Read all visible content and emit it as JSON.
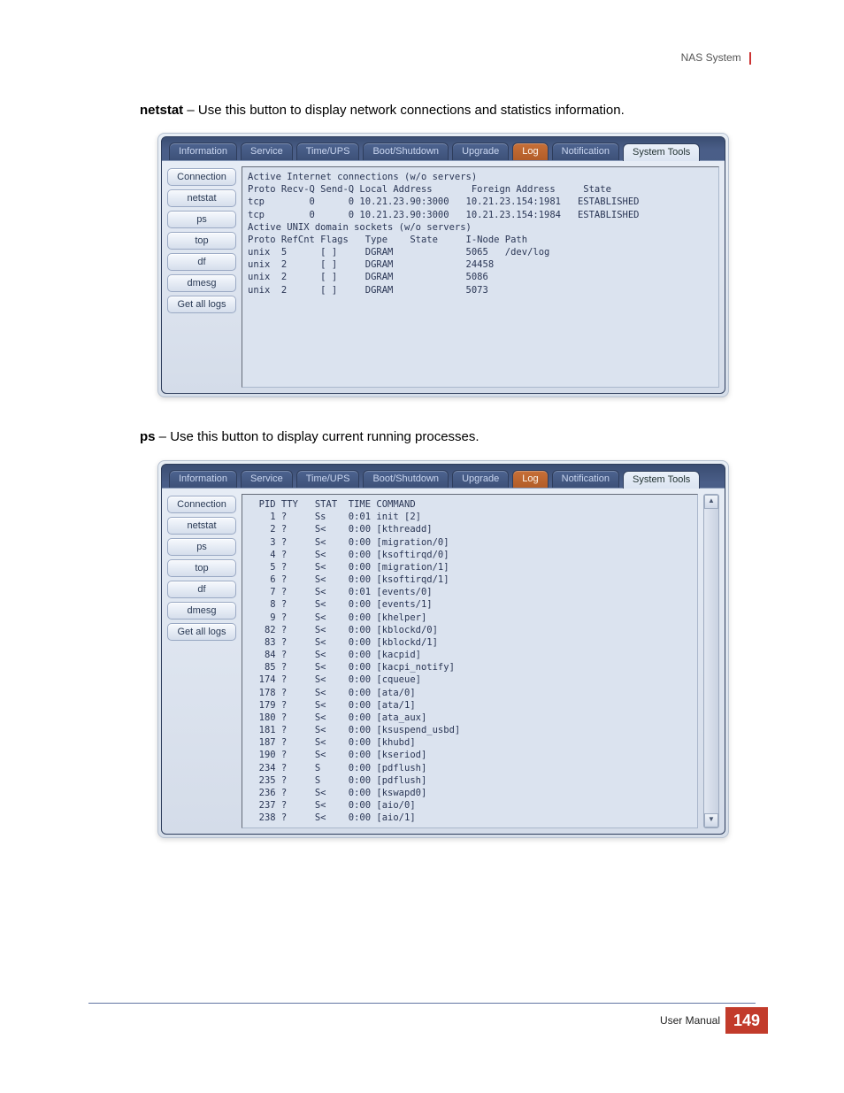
{
  "header": {
    "product": "NAS System"
  },
  "sections": {
    "netstat": {
      "name": "netstat",
      "desc": " – Use this button to display network connections and statistics information."
    },
    "ps": {
      "name": "ps",
      "desc": " – Use this button to display current running processes."
    }
  },
  "tabs": {
    "information": "Information",
    "service": "Service",
    "timeups": "Time/UPS",
    "bootshutdown": "Boot/Shutdown",
    "upgrade": "Upgrade",
    "log": "Log",
    "notification": "Notification",
    "systemtools": "System Tools"
  },
  "sidebar": [
    "Connection",
    "netstat",
    "ps",
    "top",
    "df",
    "dmesg",
    "Get all logs"
  ],
  "netstat_output": "Active Internet connections (w/o servers)\nProto Recv-Q Send-Q Local Address       Foreign Address     State\ntcp        0      0 10.21.23.90:3000   10.21.23.154:1981   ESTABLISHED\ntcp        0      0 10.21.23.90:3000   10.21.23.154:1984   ESTABLISHED\nActive UNIX domain sockets (w/o servers)\nProto RefCnt Flags   Type    State     I-Node Path\nunix  5      [ ]     DGRAM             5065   /dev/log\nunix  2      [ ]     DGRAM             24458\nunix  2      [ ]     DGRAM             5086\nunix  2      [ ]     DGRAM             5073",
  "ps_output": "  PID TTY   STAT  TIME COMMAND\n    1 ?     Ss    0:01 init [2]\n    2 ?     S<    0:00 [kthreadd]\n    3 ?     S<    0:00 [migration/0]\n    4 ?     S<    0:00 [ksoftirqd/0]\n    5 ?     S<    0:00 [migration/1]\n    6 ?     S<    0:00 [ksoftirqd/1]\n    7 ?     S<    0:01 [events/0]\n    8 ?     S<    0:00 [events/1]\n    9 ?     S<    0:00 [khelper]\n   82 ?     S<    0:00 [kblockd/0]\n   83 ?     S<    0:00 [kblockd/1]\n   84 ?     S<    0:00 [kacpid]\n   85 ?     S<    0:00 [kacpi_notify]\n  174 ?     S<    0:00 [cqueue]\n  178 ?     S<    0:00 [ata/0]\n  179 ?     S<    0:00 [ata/1]\n  180 ?     S<    0:00 [ata_aux]\n  181 ?     S<    0:00 [ksuspend_usbd]\n  187 ?     S<    0:00 [khubd]\n  190 ?     S<    0:00 [kseriod]\n  234 ?     S     0:00 [pdflush]\n  235 ?     S     0:00 [pdflush]\n  236 ?     S<    0:00 [kswapd0]\n  237 ?     S<    0:00 [aio/0]\n  238 ?     S<    0:00 [aio/1]",
  "footer": {
    "label": "User Manual",
    "page": "149"
  }
}
